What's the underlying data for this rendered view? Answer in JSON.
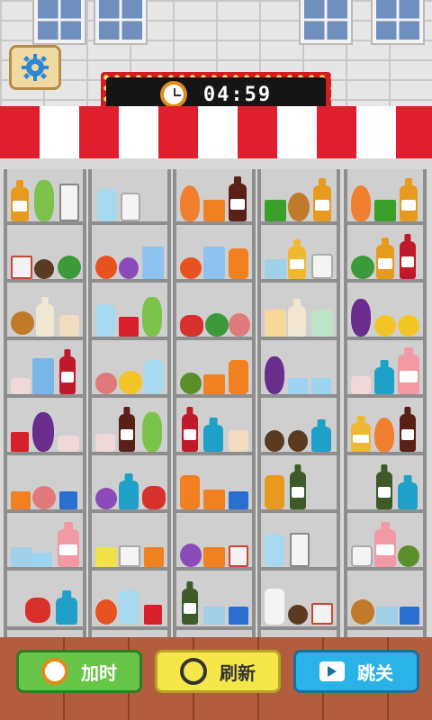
{
  "timer": {
    "time": "04:59",
    "icon": "alarm-clock-icon"
  },
  "settings": {
    "icon": "gear-icon"
  },
  "buttons": {
    "add_time_label": "加时",
    "refresh_label": "刷新",
    "skip_label": "跳关"
  },
  "colors": {
    "awning_red": "#e01e2e",
    "board_red": "#d11c22",
    "add_time": "#67c548",
    "refresh": "#f5e64a",
    "skip": "#2ab3e8"
  }
}
